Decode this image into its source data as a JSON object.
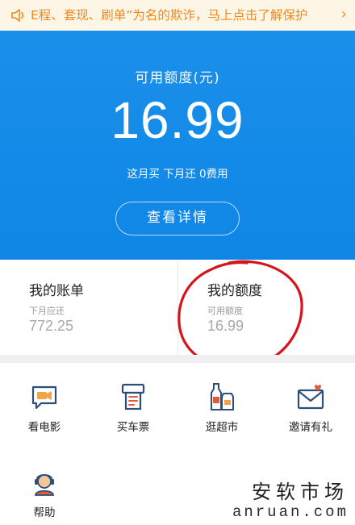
{
  "notice": {
    "text": "E程、套现、刷单”为名的欺诈，马上点击了解保护",
    "chevron": "›",
    "speaker_icon": "speaker-icon"
  },
  "hero": {
    "label": "可用额度(元)",
    "amount": "16.99",
    "subtitle": "这月买 下月还 0费用",
    "detail_button": "查看详情"
  },
  "cards": {
    "bill": {
      "title": "我的账单",
      "sublabel": "下月应还",
      "value": "772.25"
    },
    "quota": {
      "title": "我的额度",
      "sublabel": "可用额度",
      "value": "16.99"
    }
  },
  "grid": {
    "items": [
      {
        "label": "看电影",
        "icon": "movie-ticket-icon"
      },
      {
        "label": "买车票",
        "icon": "ticket-machine-icon"
      },
      {
        "label": "逛超市",
        "icon": "supermarket-icon"
      },
      {
        "label": "邀请有礼",
        "icon": "invite-envelope-icon"
      },
      {
        "label": "帮助",
        "icon": "customer-service-icon"
      }
    ]
  },
  "watermark": {
    "line1": "安软市场",
    "line2": "anruan.com"
  },
  "colors": {
    "brand_blue": "#0f86e6",
    "notice_orange": "#f08a1c",
    "annotation_red": "#d6141b"
  }
}
